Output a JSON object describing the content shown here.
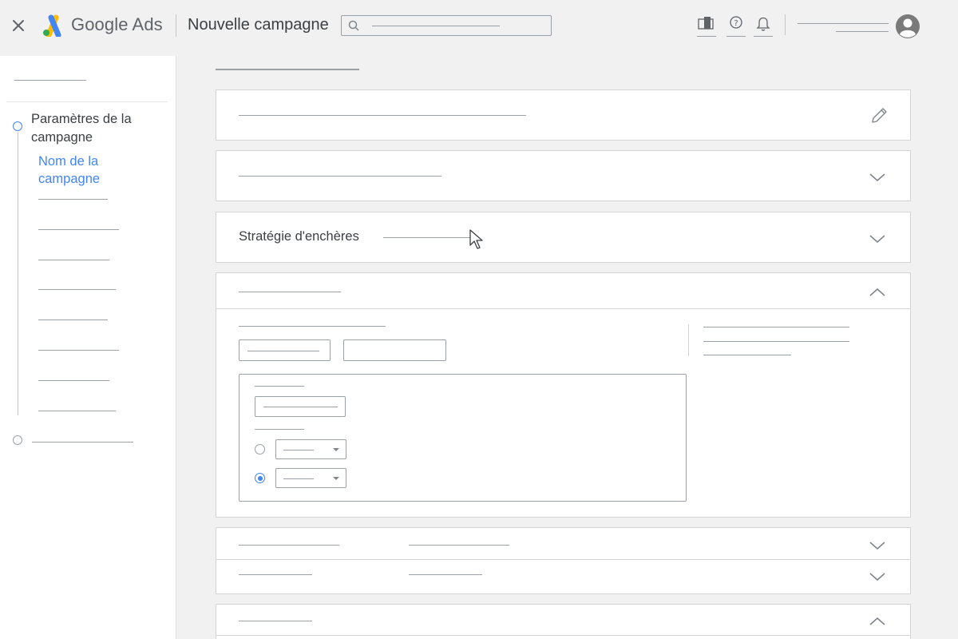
{
  "header": {
    "product_name": "Google Ads",
    "page_title": "Nouvelle campagne",
    "close_icon": "close-icon",
    "logo_icon": "google-ads-logo",
    "icons": [
      "reports-icon",
      "help-icon",
      "notifications-icon",
      "avatar-icon"
    ]
  },
  "sidebar": {
    "step1_title": "Paramètres de la campagne",
    "active_subitem": "Nom de la campagne",
    "accent_color": "#4285f4"
  },
  "main": {
    "bidding_label": "Stratégie d'enchères",
    "radio_selected_index": 1
  },
  "colors": {
    "background": "#f1f1f1",
    "card": "#ffffff",
    "accent": "#4285f4",
    "placeholder_line": "#9aa0a6"
  }
}
